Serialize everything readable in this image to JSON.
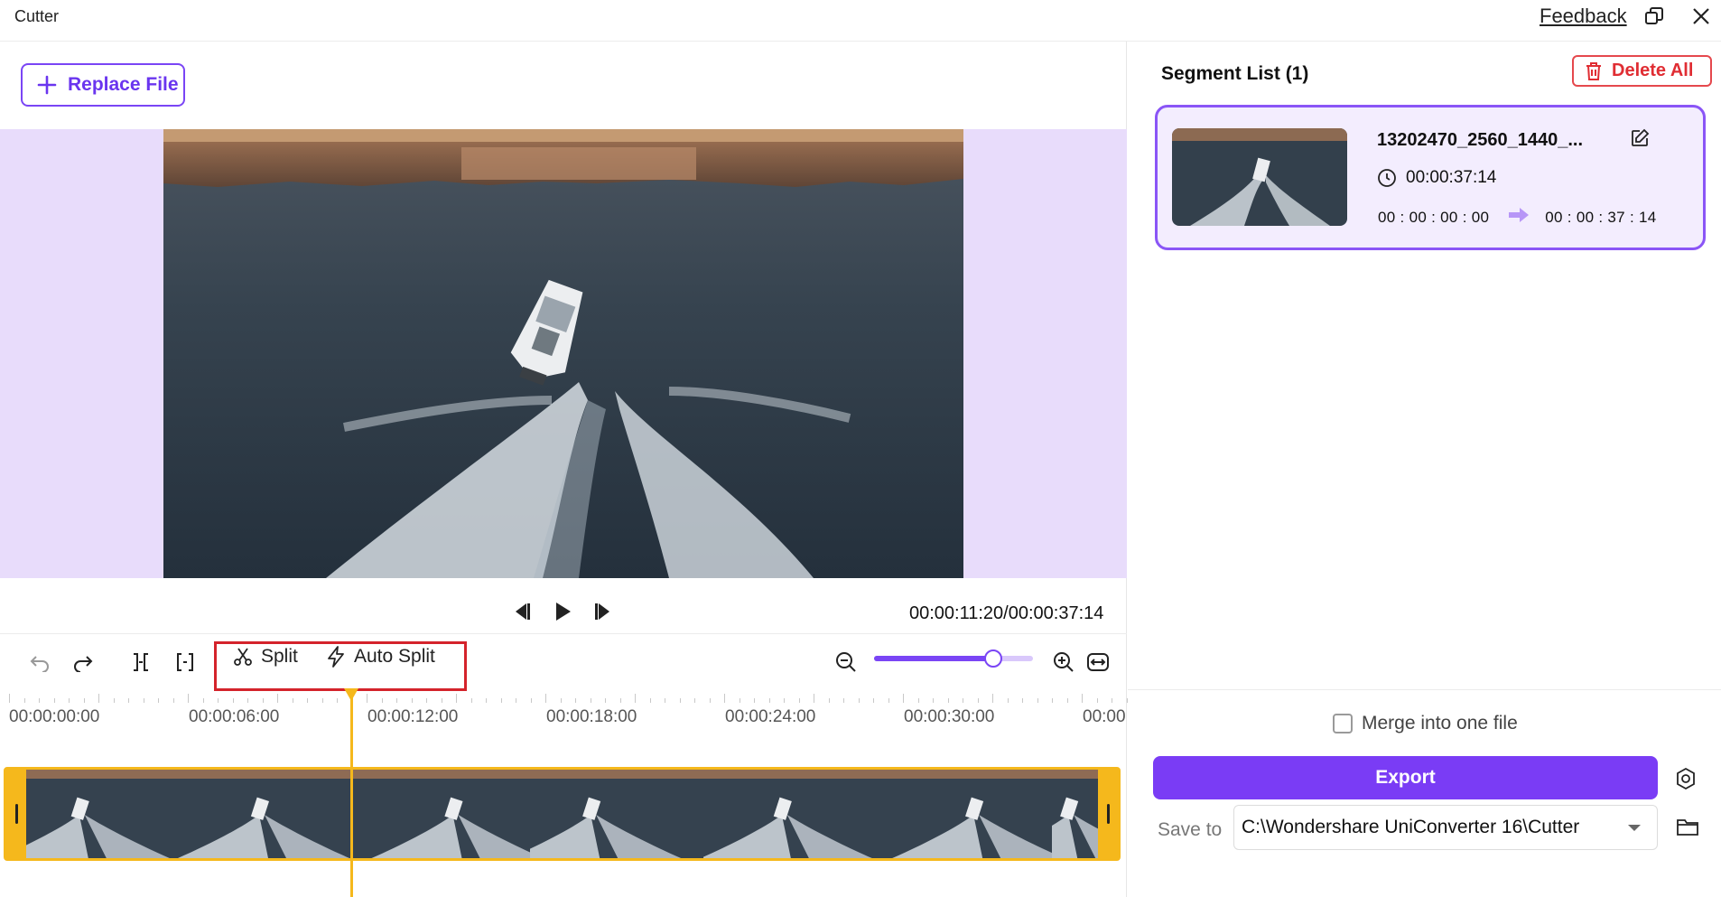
{
  "window": {
    "title": "Cutter",
    "feedback_label": "Feedback"
  },
  "file": {
    "replace_label": "Replace File"
  },
  "player": {
    "timecode": "00:00:11:20/00:00:37:14"
  },
  "toolbar": {
    "split_label": "Split",
    "auto_split_label": "Auto Split",
    "zoom_level": 0.75
  },
  "timeline": {
    "ticks": [
      "00:00:00:00",
      "00:00:06:00",
      "00:00:12:00",
      "00:00:18:00",
      "00:00:24:00",
      "00:00:30:00",
      "00:00"
    ],
    "playhead_time": "00:00:11:20"
  },
  "segments": {
    "title": "Segment List (1)",
    "delete_all_label": "Delete All",
    "items": [
      {
        "name": "13202470_2560_1440_...",
        "duration": "00:00:37:14",
        "start": "00 : 00 : 00 : 00",
        "end": "00 : 00 : 37 : 14"
      }
    ]
  },
  "output": {
    "merge_label": "Merge into one file",
    "merge_checked": false,
    "export_label": "Export",
    "save_to_label": "Save to",
    "save_path": "C:\\Wondershare UniConverter 16\\Cutter"
  },
  "colors": {
    "accent": "#7a3cf5",
    "danger": "#e02d33",
    "track": "#f5b81c",
    "preview_bg": "#e8dcfb"
  }
}
